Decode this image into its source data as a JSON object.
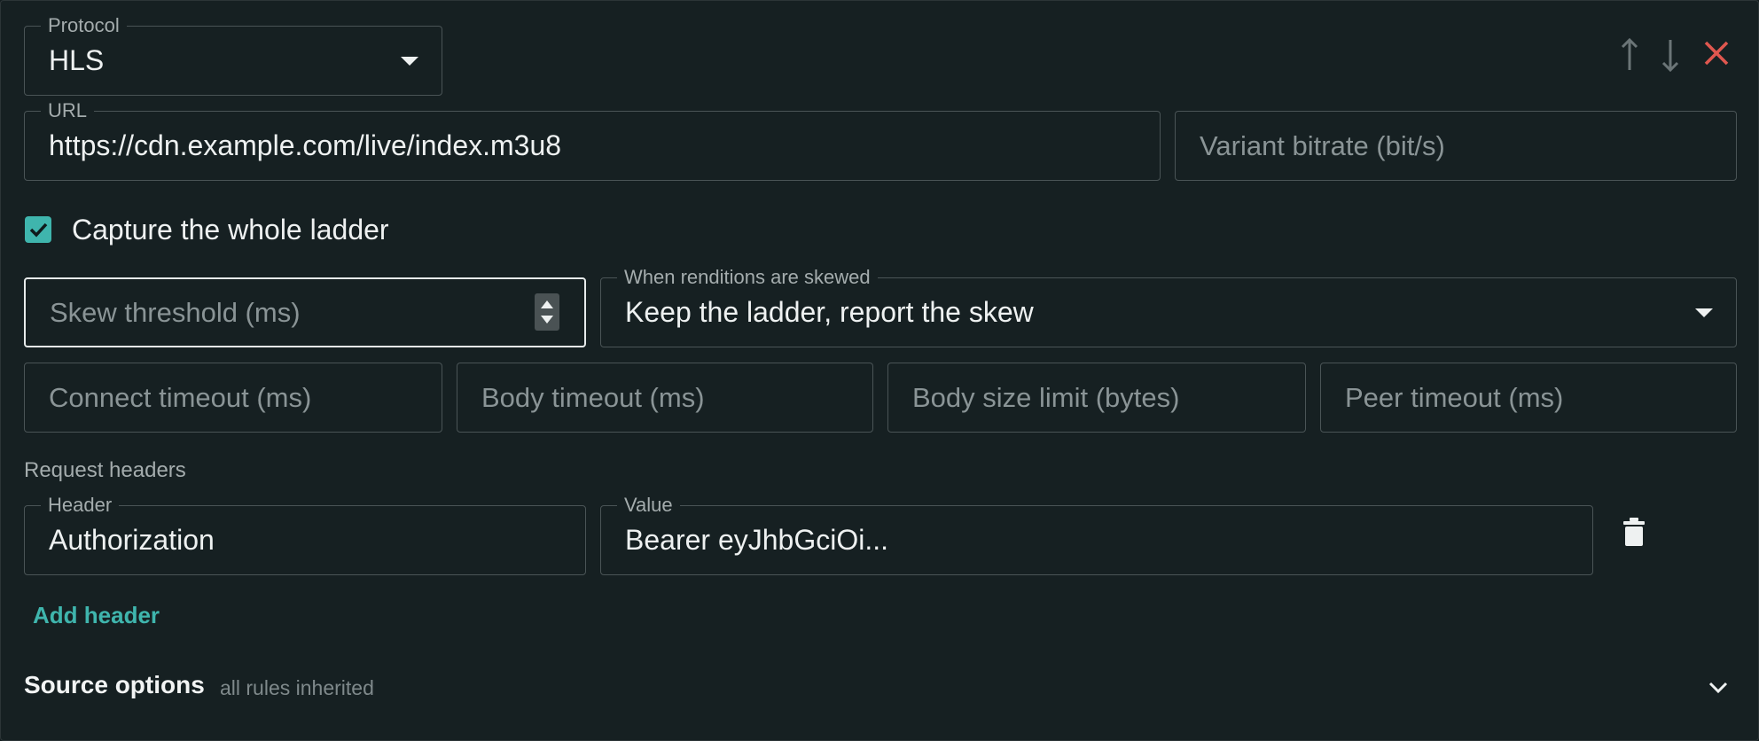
{
  "protocol": {
    "label": "Protocol",
    "value": "HLS"
  },
  "toolbar": {
    "move_up_icon": "arrow-up-icon",
    "move_down_icon": "arrow-down-icon",
    "remove_icon": "close-icon",
    "remove_color": "#e0574f"
  },
  "url": {
    "label": "URL",
    "value": "https://cdn.example.com/live/index.m3u8"
  },
  "variant_bitrate": {
    "placeholder": "Variant bitrate (bit/s)"
  },
  "capture_ladder": {
    "label": "Capture the whole ladder",
    "checked": true
  },
  "skew_threshold": {
    "placeholder": "Skew threshold (ms)"
  },
  "skew_policy": {
    "label": "When renditions are skewed",
    "value": "Keep the ladder, report the skew"
  },
  "timeouts": {
    "connect": "Connect timeout (ms)",
    "body": "Body timeout (ms)",
    "body_size": "Body size limit (bytes)",
    "peer": "Peer timeout (ms)"
  },
  "request_headers": {
    "section_label": "Request headers",
    "header_label": "Header",
    "value_label": "Value",
    "rows": [
      {
        "header": "Authorization",
        "value": "Bearer eyJhbGciOi..."
      }
    ],
    "add_label": "Add header"
  },
  "source_options": {
    "title": "Source options",
    "subtitle": "all rules inherited"
  },
  "colors": {
    "accent": "#3fb5ad",
    "background": "#162022",
    "border": "#4a5456"
  }
}
